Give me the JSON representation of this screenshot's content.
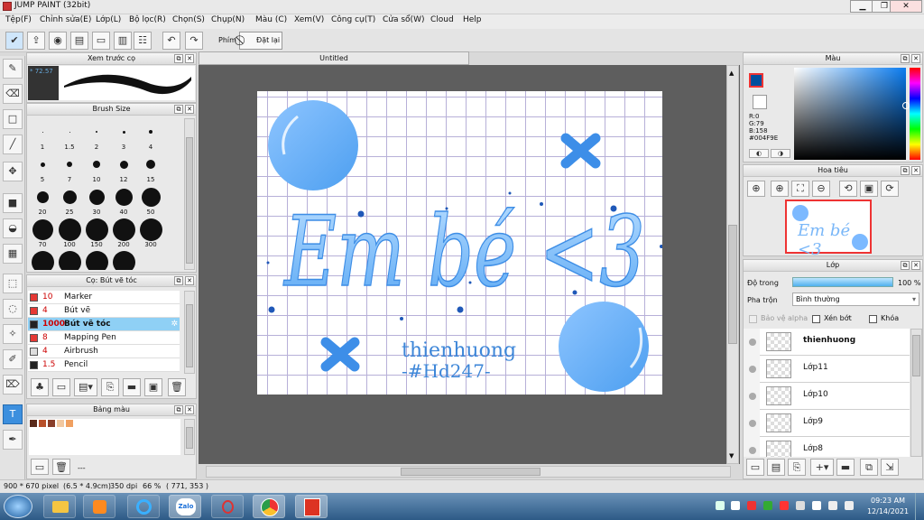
{
  "window": {
    "title": "JUMP PAINT (32bit)",
    "min": "▁",
    "max": "❐",
    "close": "✕"
  },
  "menu": [
    "Tệp(F)",
    "Chỉnh sửa(E)",
    "Lớp(L)",
    "Bộ lọc(R)",
    "Chọn(S)",
    "Chụp(N)",
    "Màu (C)",
    "Xem(V)",
    "Công cụ(T)",
    "Cửa sổ(W)",
    "Cloud",
    "Help"
  ],
  "toolbar": {
    "phim_label": "Phím",
    "reset_label": "Đặt lại"
  },
  "brush_preview": {
    "title": "Xem trước cọ",
    "size": "* 72.57"
  },
  "brush_size": {
    "title": "Brush Size",
    "sizes": [
      "1",
      "1.5",
      "2",
      "3",
      "4",
      "5",
      "7",
      "10",
      "12",
      "15",
      "20",
      "25",
      "30",
      "40",
      "50",
      "70",
      "100",
      "150",
      "200",
      "300",
      "",
      "",
      "",
      ""
    ]
  },
  "brush_list": {
    "title": "Cọ: Bút vẽ tóc",
    "items": [
      {
        "size": "10",
        "name": "Marker",
        "color": "#e53935"
      },
      {
        "size": "4",
        "name": "Bút vẽ",
        "color": "#e53935"
      },
      {
        "size": "1000",
        "name": "Bút vẽ tóc",
        "color": "#222222",
        "selected": true
      },
      {
        "size": "8",
        "name": "Mapping Pen",
        "color": "#e53935"
      },
      {
        "size": "4",
        "name": "Airbrush",
        "color": "#dddddd"
      },
      {
        "size": "1.5",
        "name": "Pencil",
        "color": "#222222"
      }
    ]
  },
  "palette": {
    "title": "Bảng màu",
    "swatches": [
      "#5a2a1a",
      "#b8502a",
      "#8a3e2a",
      "#f2c8a0",
      "#f0a060"
    ],
    "more": "---"
  },
  "canvas": {
    "tab": "Untitled",
    "main_text": "Em bé <3",
    "author": "thienhuong",
    "tag": "-#Hd247-"
  },
  "color_panel": {
    "title": "Màu",
    "r": "R:0",
    "g": "G:79",
    "b": "B:158",
    "hex": "#004F9E",
    "primary": "#004F9E"
  },
  "navigator": {
    "title": "Hoa tiêu"
  },
  "layers": {
    "title": "Lớp",
    "opacity_label": "Độ trong",
    "opacity_value": "100 %",
    "blend_label": "Pha trộn",
    "blend_value": "Bình thường",
    "protect_alpha": "Bảo vệ alpha",
    "clipping": "Xén bớt",
    "lock": "Khóa",
    "items": [
      {
        "name": "thienhuong",
        "selected": true
      },
      {
        "name": "Lớp11"
      },
      {
        "name": "Lớp10"
      },
      {
        "name": "Lớp9"
      },
      {
        "name": "Lớp8"
      }
    ]
  },
  "status": {
    "dims": "900 * 670 pixel",
    "cm": "(6.5 * 4.9cm)",
    "dpi": "350 dpi",
    "zoom": "66 %",
    "coords": "( 771, 353 )"
  },
  "taskbar": {
    "time": "09:23 AM",
    "date": "12/14/2021",
    "zalo": "Zalo"
  }
}
